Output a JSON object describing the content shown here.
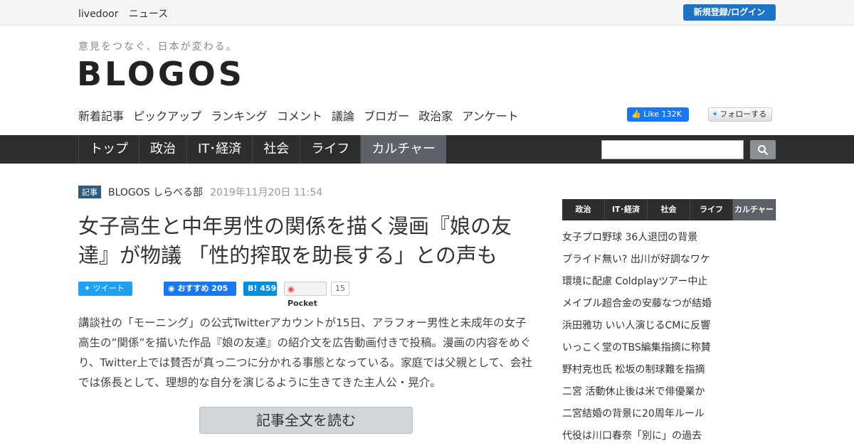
{
  "topbar": {
    "brand": "livedoor",
    "section": "ニュース",
    "login_label": "新規登録/ログイン"
  },
  "header": {
    "tagline": "意見をつなぐ、日本が変わる。",
    "logo": "BLOGOS"
  },
  "subnav": [
    "新着記事",
    "ピックアップ",
    "ランキング",
    "コメント",
    "議論",
    "ブロガー",
    "政治家",
    "アンケート"
  ],
  "social_header": {
    "fb_like_label": "Like",
    "fb_like_count": "132K",
    "twitter_follow_label": "フォローする"
  },
  "mainnav": {
    "items": [
      {
        "label": "トップ"
      },
      {
        "label": "政治"
      },
      {
        "label": "IT･経済"
      },
      {
        "label": "社会"
      },
      {
        "label": "ライフ"
      },
      {
        "label": "カルチャー"
      }
    ],
    "active_index": 5,
    "search_value": ""
  },
  "article": {
    "badge": "記事",
    "author": "BLOGOS しらべる部",
    "date": "2019年11月20日 11:54",
    "headline": "女子高生と中年男性の関係を描く漫画『娘の友達』が物議 「性的搾取を助長する」との声も",
    "summary": "講談社の「モーニング」の公式Twitterアカウントが15日、アラフォー男性と未成年の女子高生の”関係”を描いた作品『娘の友達』の紹介文を広告動画付きで投稿。漫画の内容をめぐり、Twitter上では賛否が真っ二つに分かれる事態となっている。家庭では父親として、会社では係長として、理想的な自分を演じるように生きてきた主人公・晃介。",
    "read_more_label": "記事全文を読む"
  },
  "share": {
    "tweet_label": "ツイート",
    "fb_label": "おすすめ",
    "fb_count": "205",
    "hatena_label": "B!",
    "hatena_count": "459",
    "pocket_label": "Pocket",
    "pocket_count": "15"
  },
  "sidebar": {
    "tabs": [
      "政治",
      "IT･経済",
      "社会",
      "ライフ",
      "カルチャー"
    ],
    "active_tab": 4,
    "items": [
      "女子プロ野球 36人退団の背景",
      "プライド無い? 出川が好調なワケ",
      "環境に配慮 Coldplayツアー中止",
      "メイプル超合金の安藤なつが結婚",
      "浜田雅功 いい人演じるCMに反響",
      "いっこく堂のTBS編集指摘に称賛",
      "野村克也氏 松坂の制球難を指摘",
      "二宮 活動休止後は米で俳優業か",
      "二宮結婚の背景に20周年ルール",
      "代役は川口春奈「別に」の過去"
    ]
  },
  "colors": {
    "nav_bg": "#2e2e2e",
    "nav_active": "#5c6268",
    "login_blue": "#1f73c6",
    "badge_blue": "#2f5a7c"
  }
}
